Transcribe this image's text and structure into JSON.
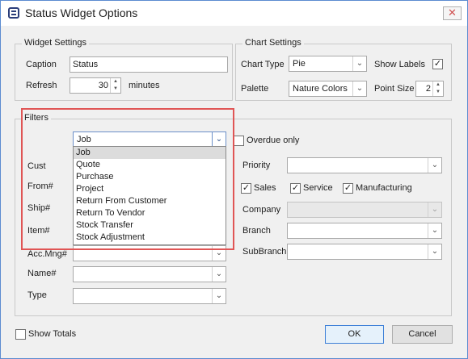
{
  "window": {
    "title": "Status Widget Options",
    "close_glyph": "✕"
  },
  "widget_settings": {
    "legend": "Widget Settings",
    "caption_label": "Caption",
    "caption_value": "Status",
    "refresh_label": "Refresh",
    "refresh_value": "30",
    "refresh_unit": "minutes"
  },
  "chart_settings": {
    "legend": "Chart Settings",
    "chart_type_label": "Chart Type",
    "chart_type_value": "Pie",
    "show_labels_label": "Show Labels",
    "show_labels_checked": true,
    "palette_label": "Palette",
    "palette_value": "Nature Colors",
    "point_size_label": "Point Size",
    "point_size_value": "2"
  },
  "filters": {
    "legend": "Filters",
    "type_combo_value": "Job",
    "dropdown_items": [
      "Job",
      "Quote",
      "Purchase",
      "Project",
      "Return From Customer",
      "Return To Vendor",
      "Stock Transfer",
      "Stock Adjustment"
    ],
    "dropdown_selected": "Job",
    "left_labels": {
      "cust": "Cust",
      "from": "From#",
      "ship": "Ship#",
      "item": "Item#",
      "acc_mng": "Acc.Mng#",
      "name": "Name#",
      "type": "Type"
    },
    "overdue_only_label": "Overdue only",
    "priority_label": "Priority",
    "sales_label": "Sales",
    "service_label": "Service",
    "manufacturing_label": "Manufacturing",
    "company_label": "Company",
    "branch_label": "Branch",
    "subbranch_label": "SubBranch"
  },
  "footer": {
    "show_totals_label": "Show Totals",
    "ok_label": "OK",
    "cancel_label": "Cancel"
  },
  "icons": {
    "check": "✓",
    "dropdown_arrow": "⌄",
    "spin_up": "▲",
    "spin_down": "▼"
  },
  "colors": {
    "highlight_border": "#e05555",
    "window_border": "#5b8bd0",
    "ok_border": "#3c7fd7"
  }
}
